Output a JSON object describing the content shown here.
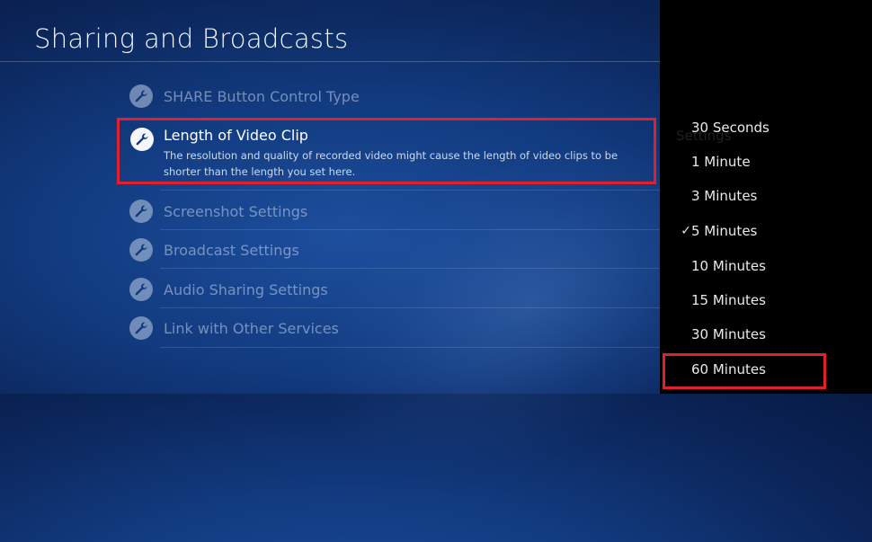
{
  "header": {
    "title": "Sharing and Broadcasts"
  },
  "menu": {
    "items": [
      {
        "label": "SHARE Button Control Type"
      },
      {
        "label": "Length of Video Clip",
        "description": "The resolution and quality of recorded video might cause the length of video clips to be shorter than the length you set here."
      },
      {
        "label": "Screenshot Settings"
      },
      {
        "label": "Broadcast Settings"
      },
      {
        "label": "Audio Sharing Settings"
      },
      {
        "label": "Link with Other Services"
      }
    ]
  },
  "panel": {
    "ghost_text": "Settings",
    "options": [
      {
        "label": "30 Seconds",
        "checked": false
      },
      {
        "label": "1 Minute",
        "checked": false
      },
      {
        "label": "3 Minutes",
        "checked": false
      },
      {
        "label": "5 Minutes",
        "checked": true
      },
      {
        "label": "10 Minutes",
        "checked": false
      },
      {
        "label": "15 Minutes",
        "checked": false
      },
      {
        "label": "30 Minutes",
        "checked": false
      },
      {
        "label": "60 Minutes",
        "checked": false
      }
    ],
    "check_glyph": "✓"
  },
  "colors": {
    "highlight": "#e0202a",
    "background": "#123b80",
    "panel": "#000000"
  }
}
